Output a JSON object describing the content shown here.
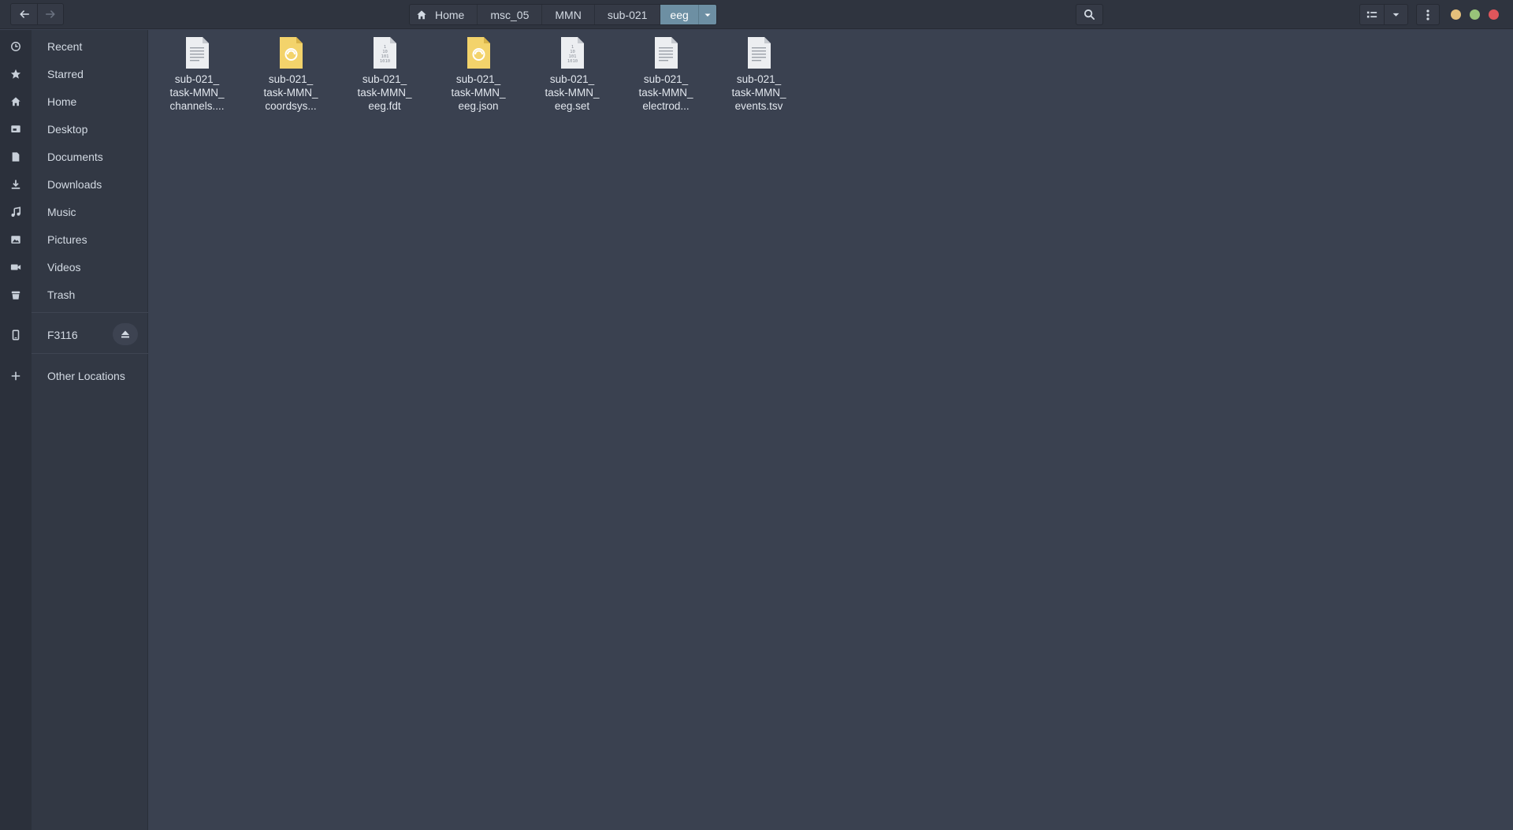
{
  "header": {
    "back_icon": "arrow-left-icon",
    "forward_icon": "arrow-right-icon",
    "breadcrumbs": [
      "Home",
      "msc_05",
      "MMN",
      "sub-021",
      "eeg"
    ],
    "search_icon": "search-icon",
    "view_icon": "list-view-icon",
    "view_menu_icon": "chevron-down-icon",
    "menu_icon": "kebab-menu-icon",
    "window_buttons": {
      "minimize_color": "#e5c07b",
      "maximize_color": "#98c379",
      "close_color": "#e0565b"
    },
    "accent_color": "#6d8fa3"
  },
  "sidebar": {
    "places": [
      {
        "label": "Recent",
        "icon": "clock-icon"
      },
      {
        "label": "Starred",
        "icon": "star-icon"
      },
      {
        "label": "Home",
        "icon": "home-icon"
      },
      {
        "label": "Desktop",
        "icon": "desktop-icon"
      },
      {
        "label": "Documents",
        "icon": "document-icon"
      },
      {
        "label": "Downloads",
        "icon": "download-icon"
      },
      {
        "label": "Music",
        "icon": "music-icon"
      },
      {
        "label": "Pictures",
        "icon": "picture-icon"
      },
      {
        "label": "Videos",
        "icon": "video-icon"
      },
      {
        "label": "Trash",
        "icon": "trash-icon"
      }
    ],
    "devices": [
      {
        "label": "F3116",
        "icon": "phone-icon",
        "eject_icon": "eject-icon"
      }
    ],
    "other": {
      "label": "Other Locations",
      "icon": "plus-icon"
    }
  },
  "files": [
    {
      "name": "sub-021_\ntask-MMN_\nchannels....",
      "icon": "text-file-icon"
    },
    {
      "name": "sub-021_\ntask-MMN_\ncoordsys...",
      "icon": "json-file-icon"
    },
    {
      "name": "sub-021_\ntask-MMN_\neeg.fdt",
      "icon": "binary-file-icon"
    },
    {
      "name": "sub-021_\ntask-MMN_\neeg.json",
      "icon": "json-file-icon"
    },
    {
      "name": "sub-021_\ntask-MMN_\neeg.set",
      "icon": "binary-file-icon"
    },
    {
      "name": "sub-021_\ntask-MMN_\nelectrod...",
      "icon": "text-file-icon"
    },
    {
      "name": "sub-021_\ntask-MMN_\nevents.tsv",
      "icon": "text-file-icon"
    }
  ]
}
